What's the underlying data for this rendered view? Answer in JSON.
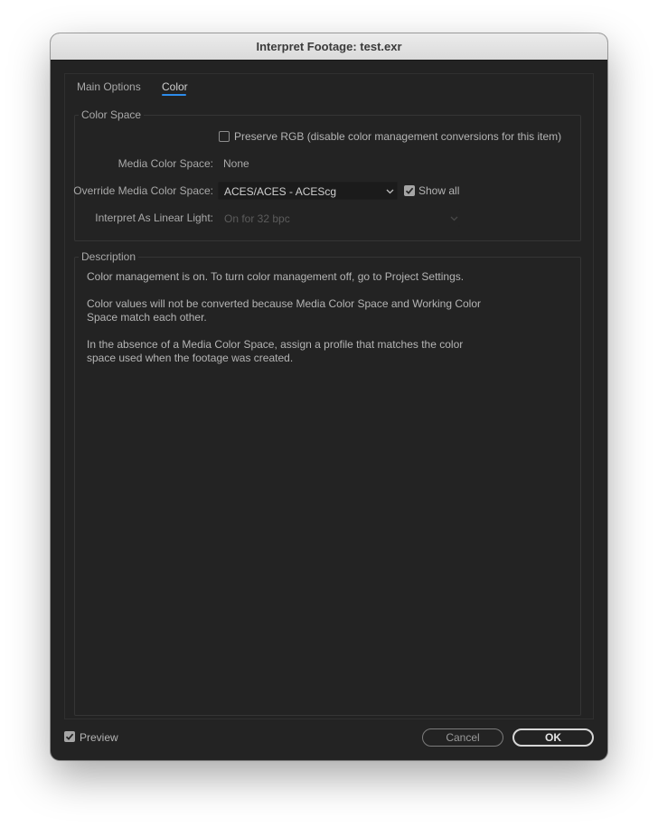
{
  "window": {
    "title": "Interpret Footage: test.exr"
  },
  "tabs": [
    {
      "label": "Main Options",
      "active": false
    },
    {
      "label": "Color",
      "active": true
    }
  ],
  "color_space": {
    "group_label": "Color Space",
    "preserve_rgb": {
      "label": "Preserve RGB (disable color management conversions for this item)",
      "checked": false
    },
    "media_color_space": {
      "label": "Media Color Space:",
      "value": "None"
    },
    "override_media_color_space": {
      "label": "Override Media Color Space:",
      "value": "ACES/ACES - ACEScg"
    },
    "show_all": {
      "label": "Show all",
      "checked": true
    },
    "interpret_linear": {
      "label": "Interpret As Linear Light:",
      "value": "On for 32 bpc",
      "disabled": true
    }
  },
  "description": {
    "group_label": "Description",
    "lines": [
      "Color management is on. To turn color management off, go to Project Settings.",
      "Color values will not be converted because Media Color Space and Working Color",
      "Space match each other.",
      "In the absence of a Media Color Space, assign a profile that matches the color",
      "space used when the footage was created."
    ]
  },
  "footer": {
    "preview": {
      "label": "Preview",
      "checked": true
    },
    "cancel_label": "Cancel",
    "ok_label": "OK"
  },
  "colors": {
    "dialog_bg": "#232323",
    "accent_blue": "#2d8ceb",
    "text": "#a9a9a9"
  }
}
